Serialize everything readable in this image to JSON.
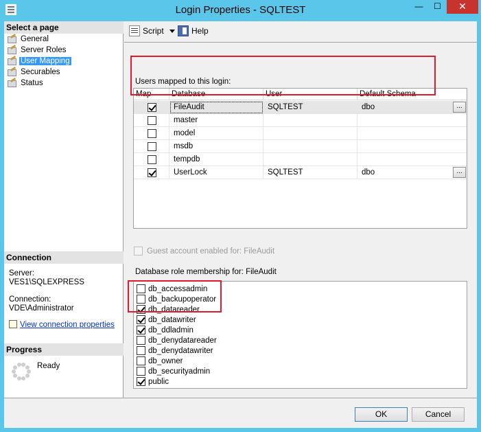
{
  "window": {
    "title": "Login Properties - SQLTEST",
    "minimize": "—",
    "maximize": "☐",
    "close": "✕"
  },
  "left_panel": {
    "select_page_header": "Select a page",
    "pages": [
      {
        "label": "General",
        "selected": false
      },
      {
        "label": "Server Roles",
        "selected": false
      },
      {
        "label": "User Mapping",
        "selected": true
      },
      {
        "label": "Securables",
        "selected": false
      },
      {
        "label": "Status",
        "selected": false
      }
    ],
    "connection_header": "Connection",
    "server_label": "Server:",
    "server_value": "VES1\\SQLEXPRESS",
    "connection_label": "Connection:",
    "connection_value": "VDE\\Administrator",
    "view_connection_link": "View connection properties",
    "progress_header": "Progress",
    "progress_status": "Ready"
  },
  "toolbar": {
    "script_label": "Script",
    "help_label": "Help"
  },
  "mapping": {
    "group_label": "Users mapped to this login:",
    "columns": [
      "Map",
      "Database",
      "User",
      "Default Schema"
    ],
    "rows": [
      {
        "map": true,
        "database": "FileAudit",
        "user": "SQLTEST",
        "schema": "dbo",
        "has_button": true,
        "selected": true
      },
      {
        "map": false,
        "database": "master",
        "user": "",
        "schema": "",
        "has_button": false,
        "selected": false
      },
      {
        "map": false,
        "database": "model",
        "user": "",
        "schema": "",
        "has_button": false,
        "selected": false
      },
      {
        "map": false,
        "database": "msdb",
        "user": "",
        "schema": "",
        "has_button": false,
        "selected": false
      },
      {
        "map": false,
        "database": "tempdb",
        "user": "",
        "schema": "",
        "has_button": false,
        "selected": false
      },
      {
        "map": true,
        "database": "UserLock",
        "user": "SQLTEST",
        "schema": "dbo",
        "has_button": true,
        "selected": false
      }
    ],
    "ellipsis_label": "..."
  },
  "guest_account": {
    "label": "Guest account enabled for: FileAudit",
    "checked": false,
    "enabled": false
  },
  "roles": {
    "group_label": "Database role membership for: FileAudit",
    "items": [
      {
        "label": "db_accessadmin",
        "checked": false
      },
      {
        "label": "db_backupoperator",
        "checked": false
      },
      {
        "label": "db_datareader",
        "checked": true
      },
      {
        "label": "db_datawriter",
        "checked": true
      },
      {
        "label": "db_ddladmin",
        "checked": true
      },
      {
        "label": "db_denydatareader",
        "checked": false
      },
      {
        "label": "db_denydatawriter",
        "checked": false
      },
      {
        "label": "db_owner",
        "checked": false
      },
      {
        "label": "db_securityadmin",
        "checked": false
      },
      {
        "label": "public",
        "checked": true
      }
    ]
  },
  "footer": {
    "ok_label": "OK",
    "cancel_label": "Cancel"
  },
  "colors": {
    "title_bar": "#5ac6ea",
    "highlight_box": "#e01b2b",
    "selection": "#3399ff",
    "close_button": "#c7342d"
  }
}
